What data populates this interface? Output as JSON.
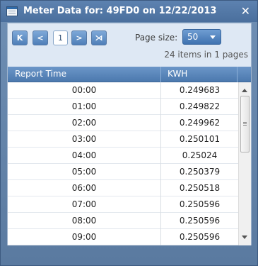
{
  "window": {
    "title": "Meter Data for: 49FD0 on 12/22/2013",
    "close_label": "✕"
  },
  "pager": {
    "first_label": "K",
    "prev_label": "<",
    "current_page": "1",
    "next_label": ">",
    "last_label": "⋊",
    "page_size_label": "Page size:",
    "page_size_value": "50",
    "items_info": "24 items in 1 pages"
  },
  "grid": {
    "columns": [
      "Report Time",
      "KWH"
    ],
    "rows": [
      {
        "time": "00:00",
        "kwh": "0.249683"
      },
      {
        "time": "01:00",
        "kwh": "0.249822"
      },
      {
        "time": "02:00",
        "kwh": "0.249962"
      },
      {
        "time": "03:00",
        "kwh": "0.250101"
      },
      {
        "time": "04:00",
        "kwh": "0.25024"
      },
      {
        "time": "05:00",
        "kwh": "0.250379"
      },
      {
        "time": "06:00",
        "kwh": "0.250518"
      },
      {
        "time": "07:00",
        "kwh": "0.250596"
      },
      {
        "time": "08:00",
        "kwh": "0.250596"
      },
      {
        "time": "09:00",
        "kwh": "0.250596"
      }
    ]
  },
  "colors": {
    "header_blue": "#4c79ae",
    "pager_bg": "#dee8f4"
  }
}
